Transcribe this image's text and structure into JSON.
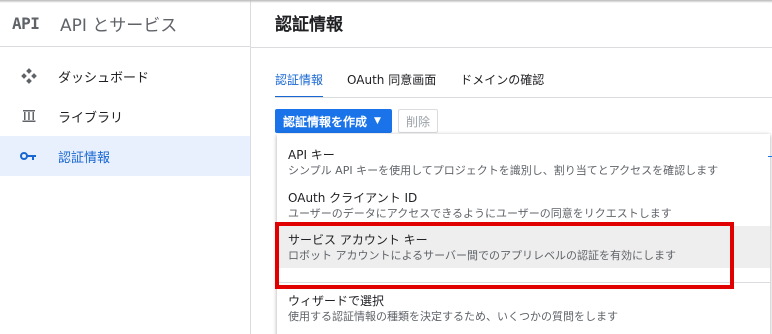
{
  "sidebar": {
    "logo": "API",
    "title": "API とサービス",
    "items": [
      {
        "label": "ダッシュボード"
      },
      {
        "label": "ライブラリ"
      },
      {
        "label": "認証情報"
      }
    ]
  },
  "main": {
    "title": "認証情報",
    "tabs": [
      {
        "label": "認証情報"
      },
      {
        "label": "OAuth 同意画面"
      },
      {
        "label": "ドメインの確認"
      }
    ],
    "create_label": "認証情報を作成",
    "delete_label": "削除"
  },
  "menu": {
    "items": [
      {
        "title": "API キー",
        "desc": "シンプル API キーを使用してプロジェクトを識別し、割り当てとアクセスを確認します"
      },
      {
        "title": "OAuth クライアント ID",
        "desc": "ユーザーのデータにアクセスできるようにユーザーの同意をリクエストします"
      },
      {
        "title": "サービス アカウント キー",
        "desc": "ロボット アカウントによるサーバー間でのアプリレベルの認証を有効にします"
      },
      {
        "title": "ウィザードで選択",
        "desc": "使用する認証情報の種類を決定するため、いくつかの質問をします"
      }
    ]
  },
  "colors": {
    "accent": "#1a73e8",
    "highlight_box": "#e00000"
  }
}
